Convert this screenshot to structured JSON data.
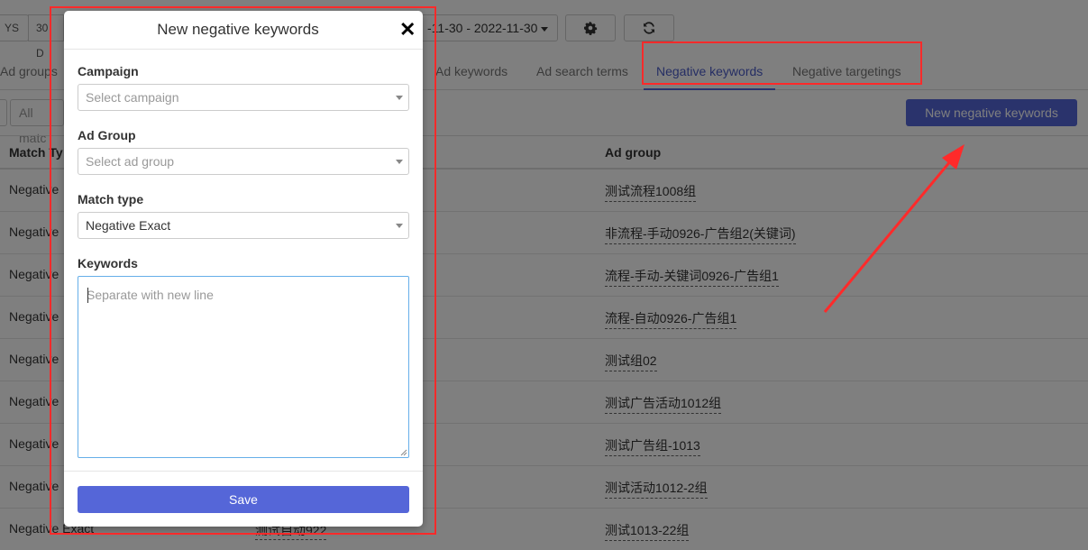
{
  "toolbar": {
    "range_fragment_1": "YS",
    "range_fragment_2": "30 D",
    "date_range": "-11-30 - 2022-11-30",
    "settings_icon": "gear-icon",
    "refresh_icon": "refresh-icon"
  },
  "tabs": [
    {
      "label": "Ad groups"
    },
    {
      "label": "Ad keywords"
    },
    {
      "label": "Ad search terms"
    },
    {
      "label": "Negative keywords",
      "active": true
    },
    {
      "label": "Negative targetings"
    }
  ],
  "filter": {
    "match_select": "All matc",
    "new_button": "New negative keywords"
  },
  "table": {
    "headers": {
      "match_type": "Match Ty",
      "ad_group": "Ad group"
    },
    "rows": [
      {
        "match_type": "Negative",
        "ad_group": "测试流程1008组"
      },
      {
        "match_type": "Negative",
        "ad_group": "非流程-手动0926-广告组2(关键词)"
      },
      {
        "match_type": "Negative",
        "ad_group": "流程-手动-关键词0926-广告组1"
      },
      {
        "match_type": "Negative",
        "ad_group": "流程-自动0926-广告组1"
      },
      {
        "match_type": "Negative",
        "ad_group": "测试组02"
      },
      {
        "match_type": "Negative",
        "ad_group": "测试广告活动1012组"
      },
      {
        "match_type": "Negative",
        "ad_group": "测试广告组-1013"
      },
      {
        "match_type": "Negative",
        "ad_group": "测试活动1012-2组"
      },
      {
        "match_type": "Negative Exact",
        "campaign": "测试自动922",
        "ad_group": "测试1013-22组"
      }
    ]
  },
  "modal": {
    "title": "New negative keywords",
    "close_icon": "close-icon",
    "campaign": {
      "label": "Campaign",
      "placeholder": "Select campaign"
    },
    "ad_group": {
      "label": "Ad Group",
      "placeholder": "Select ad group"
    },
    "match_type": {
      "label": "Match type",
      "value": "Negative Exact"
    },
    "keywords": {
      "label": "Keywords",
      "placeholder": "Separate with new line"
    },
    "save_label": "Save"
  },
  "colors": {
    "accent": "#5566d8",
    "annotation": "#ff2a2a"
  }
}
